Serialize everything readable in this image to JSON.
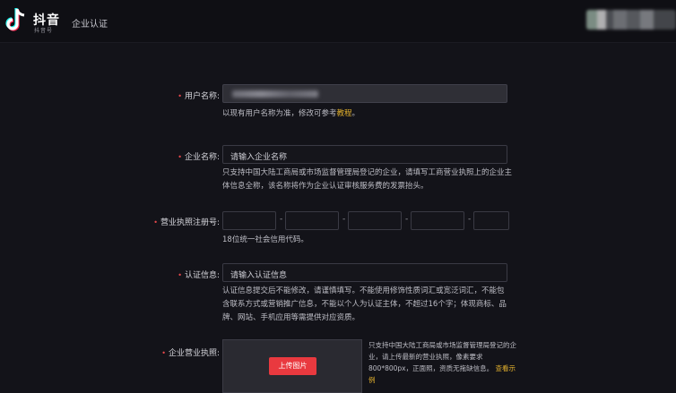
{
  "header": {
    "logo_text": "抖音",
    "logo_sub": "抖音号",
    "nav_title": "企业认证"
  },
  "form": {
    "username": {
      "label": "用户名称:",
      "help_prefix": "以现有用户名称为准，修改可参考",
      "help_link": "教程",
      "help_suffix": "。"
    },
    "company": {
      "label": "企业名称:",
      "placeholder": "请输入企业名称",
      "help": "只支持中国大陆工商局或市场监督管理局登记的企业，请填写工商营业执照上的企业主体信息全称，该名称将作为企业认证审核服务费的发票抬头。"
    },
    "license_number": {
      "label": "营业执照注册号:",
      "separator": "-",
      "help": "18位统一社会信用代码。"
    },
    "cert_info": {
      "label": "认证信息:",
      "placeholder": "请输入认证信息",
      "help": "认证信息提交后不能修改，请谨慎填写。不能使用修饰性质词汇或宽泛词汇，不能包含联系方式或营销推广信息，不能以个人为认证主体，不超过16个字；体现商标、品牌、网站、手机应用等需提供对应资质。"
    },
    "business_license": {
      "label": "企业营业执照:",
      "upload_button": "上传图片",
      "help": "只支持中国大陆工商局或市场监督管理局登记的企业，请上传最新的营业执照，像素要求800*800px，正面照，资质无拖缺信息。",
      "help_link": "查看示例"
    }
  },
  "colors": {
    "background": "#131319",
    "accent": "#e9393f",
    "link": "#e3b12d",
    "required": "#e8484c"
  }
}
